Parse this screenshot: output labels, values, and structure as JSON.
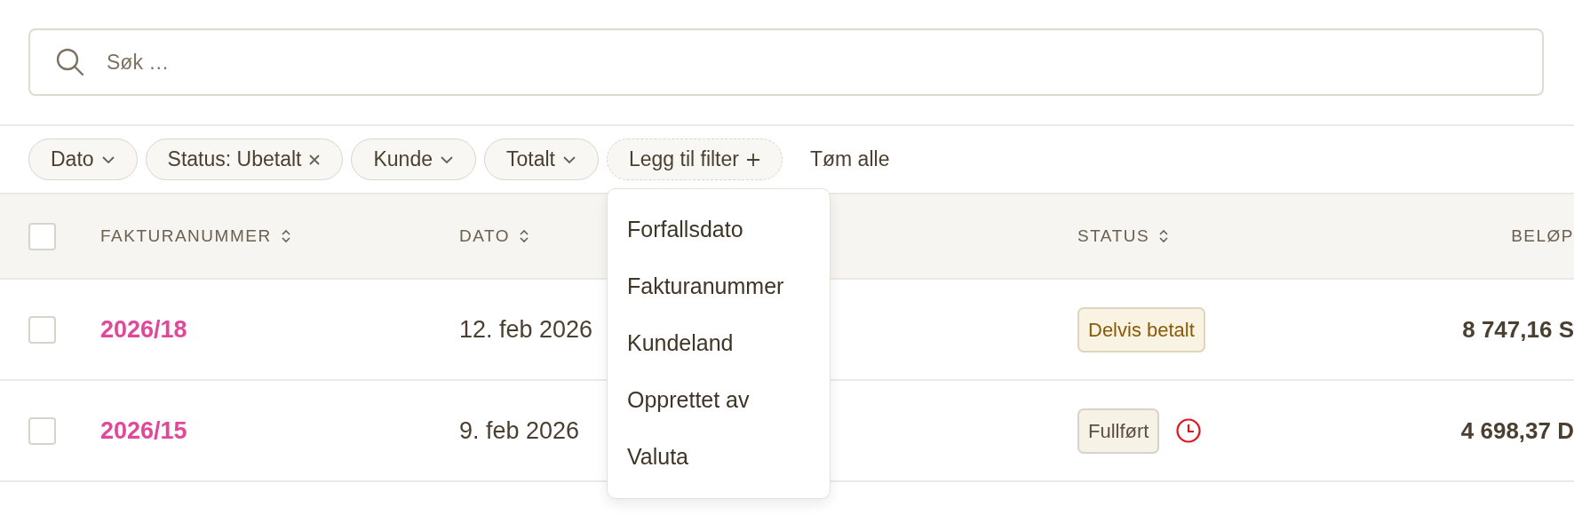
{
  "search": {
    "placeholder": "Søk …"
  },
  "filters": [
    {
      "label": "Dato",
      "kind": "dropdown"
    },
    {
      "label": "Status: Ubetalt",
      "kind": "removable"
    },
    {
      "label": "Kunde",
      "kind": "dropdown"
    },
    {
      "label": "Totalt",
      "kind": "dropdown"
    }
  ],
  "add_filter": {
    "label": "Legg til filter",
    "expanded": true,
    "menu": [
      "Forfallsdato",
      "Fakturanummer",
      "Kundeland",
      "Opprettet av",
      "Valuta"
    ]
  },
  "clear_all": "Tøm alle",
  "table": {
    "select_all_checked": false,
    "columns": [
      {
        "label": "FAKTURANUMMER",
        "sortable": true
      },
      {
        "label": "DATO",
        "sortable": true
      },
      {
        "label": "STATUS",
        "sortable": true
      },
      {
        "label": "BELØP",
        "sortable": false
      }
    ],
    "rows": [
      {
        "checked": false,
        "number": "2026/18",
        "date": "12. feb 2026",
        "status": "Delvis betalt",
        "color": "#8a5a08",
        "overdue": false,
        "amount": "8 747,16 S"
      },
      {
        "checked": false,
        "number": "2026/15",
        "date": "9. feb 2026",
        "status": "Fullført",
        "color": "#5b5040",
        "overdue": true,
        "amount": "4 698,37 D"
      }
    ]
  }
}
